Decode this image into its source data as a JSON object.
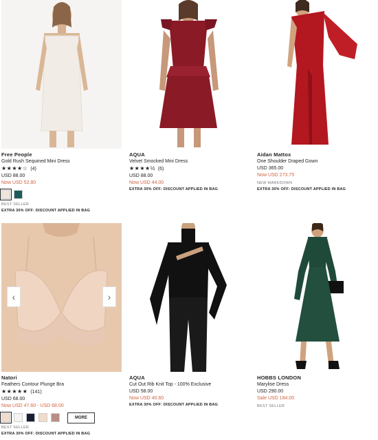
{
  "products": [
    {
      "brand": "Free People",
      "name": "Gold Rush Sequined Mini Dress",
      "stars": "★★★★☆",
      "review_count": "(4)",
      "price": "USD 88.00",
      "sale_price": "Now USD 52.80",
      "swatch_colors": [
        "#efe7dd",
        "#1d5b58"
      ],
      "tag": "BEST SELLER",
      "promo": "EXTRA 30% OFF: DISCOUNT APPLIED IN BAG"
    },
    {
      "brand": "AQUA",
      "name": "Velvet Smocked Mini Dress",
      "stars": "★★★★½",
      "review_count": "(6)",
      "price": "USD 88.00",
      "sale_price": "Now USD 44.00",
      "promo": "EXTRA 30% OFF: DISCOUNT APPLIED IN BAG"
    },
    {
      "brand": "Aidan Mattox",
      "name": "One Shoulder Draped Gown",
      "price": "USD 365.00",
      "sale_price": "Now USD 273.75",
      "tag": "NEW MARKDOWN",
      "promo": "EXTRA 30% OFF: DISCOUNT APPLIED IN BAG"
    },
    {
      "brand": "Natori",
      "name": "Feathers Contour Plunge Bra",
      "stars": "★★★★★",
      "review_count": "(141)",
      "price": "USD 68.00",
      "sale_price": "Now USD 47.60 - USD 68.00",
      "swatch_colors": [
        "#f1ddd0",
        "#f6f4f1",
        "#1a1f33",
        "#efdcc9",
        "#b98e85"
      ],
      "more_label": "MORE",
      "tag": "BEST SELLER",
      "promo": "EXTRA 30% OFF: DISCOUNT APPLIED IN BAG"
    },
    {
      "brand": "AQUA",
      "name": "Cut Out Rib Knit Top - 100% Exclusive",
      "price": "USD 58.00",
      "sale_price": "Now USD 40.60",
      "promo": "EXTRA 30% OFF: DISCOUNT APPLIED IN BAG"
    },
    {
      "brand": "HOBBS LONDON",
      "name": "Marylise Dress",
      "price": "USD 290.00",
      "sale_price": "Sale USD 184.00",
      "tag": "BEST SELLER"
    }
  ],
  "carousel": {
    "prev_glyph": "‹",
    "next_glyph": "›"
  },
  "colors": {
    "sale": "#d0623f"
  }
}
